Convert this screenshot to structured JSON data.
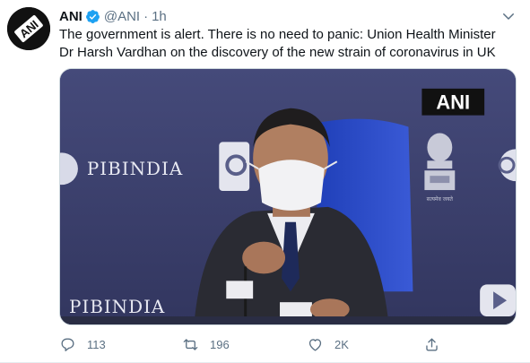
{
  "tweet": {
    "author_name": "ANI",
    "handle": "@ANI",
    "separator": "·",
    "time": "1h",
    "text": "The government is alert. There is no need to panic: Union Health Minister Dr Harsh Vardhan on the discovery of the new strain of coronavirus in UK",
    "avatar_text": "ANI",
    "media": {
      "watermark": "ANI",
      "backdrop_text_top": "PIBINDIA",
      "backdrop_text_bottom": "PIBINDIA",
      "emblem_caption": "सत्यमेव जयते"
    },
    "actions": {
      "reply_count": "113",
      "retweet_count": "196",
      "like_count": "2K"
    }
  },
  "colors": {
    "accent": "#1da1f2",
    "muted": "#5b7083",
    "media_background": "#3a3e6e"
  },
  "icons": [
    "verified-badge-icon",
    "more-chevron-icon",
    "reply-icon",
    "retweet-icon",
    "like-icon",
    "share-icon"
  ]
}
